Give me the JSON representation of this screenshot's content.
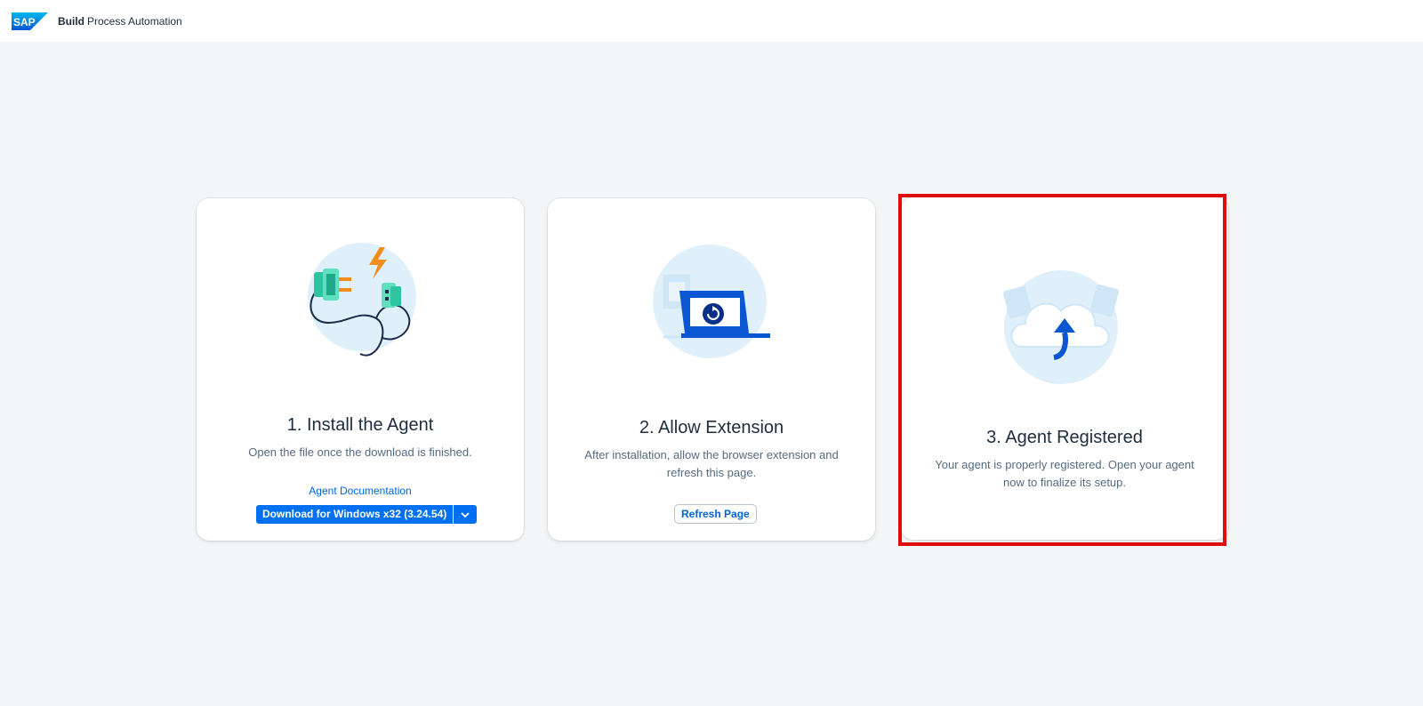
{
  "header": {
    "logo_text": "SAP",
    "title_bold": "Build",
    "title_rest": "Process Automation"
  },
  "steps": [
    {
      "title": "1. Install the Agent",
      "description": "Open the file once the download is finished.",
      "link": "Agent Documentation",
      "button": "Download for Windows x32 (3.24.54)",
      "illustration": "plug-connector-icon"
    },
    {
      "title": "2. Allow Extension",
      "description": "After installation, allow the browser extension and refresh this page.",
      "button": "Refresh Page",
      "illustration": "laptop-refresh-icon"
    },
    {
      "title": "3. Agent Registered",
      "description": "Your agent is properly registered. Open your agent now to finalize its setup.",
      "illustration": "cloud-upload-icon"
    }
  ],
  "colors": {
    "brand_blue": "#0070f2",
    "link_blue": "#0064d9",
    "highlight_red": "#e00d0d",
    "background": "#f4f5f7"
  }
}
